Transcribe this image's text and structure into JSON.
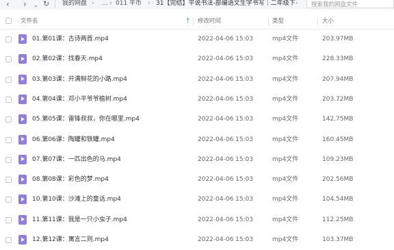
{
  "toolbar": {
    "back_icon": "chevron-left-icon",
    "forward_icon": "chevron-right-icon",
    "dropdown_icon": "chevron-down-icon",
    "refresh_icon": "refresh-icon",
    "breadcrumb": [
      "我的网盘",
      "...",
      "011 平币",
      "31【完结】平说书法-部编语文生字书写｜二年级下"
    ],
    "search_placeholder": "搜索我的网盘文件"
  },
  "columns": {
    "name": "文件名",
    "modified": "修改时间",
    "type": "类型",
    "size": "大小"
  },
  "files": [
    {
      "name": "01.第01课：古诗两首.mp4",
      "modified": "2022-04-06 15:03",
      "type": "mp4文件",
      "size": "203.97MB"
    },
    {
      "name": "02.第02课：找春天.mp4",
      "modified": "2022-04-06 15:03",
      "type": "mp4文件",
      "size": "228.33MB"
    },
    {
      "name": "03.第03课：开满鲜花的小路.mp4",
      "modified": "2022-04-06 15:03",
      "type": "mp4文件",
      "size": "207.94MB"
    },
    {
      "name": "04.第04课：邓小平爷爷植树.mp4",
      "modified": "2022-04-06 15:03",
      "type": "mp4文件",
      "size": "203.72MB"
    },
    {
      "name": "05.第05课：雷锋叔叔，你在哪里.mp4",
      "modified": "2022-04-06 15:03",
      "type": "mp4文件",
      "size": "142.75MB"
    },
    {
      "name": "06.第06课：陶罐和铁罐.mp4",
      "modified": "2022-04-06 15:03",
      "type": "mp4文件",
      "size": "160.45MB"
    },
    {
      "name": "07.第07课：一匹出色的马.mp4",
      "modified": "2022-04-06 15:03",
      "type": "mp4文件",
      "size": "109.23MB"
    },
    {
      "name": "08.第08课：彩色的梦.mp4",
      "modified": "2022-04-06 15:03",
      "type": "mp4文件",
      "size": "202.56MB"
    },
    {
      "name": "10.第10课：沙滩上的童话.mp4",
      "modified": "2022-04-06 15:03",
      "type": "mp4文件",
      "size": "104.54MB"
    },
    {
      "name": "11.第11课：我是一只小虫子.mp4",
      "modified": "2022-04-06 15:03",
      "type": "mp4文件",
      "size": "112.25MB"
    },
    {
      "name": "12.第12课：寓言二则.mp4",
      "modified": "2022-04-06 15:03",
      "type": "mp4文件",
      "size": "103.37MB"
    }
  ]
}
